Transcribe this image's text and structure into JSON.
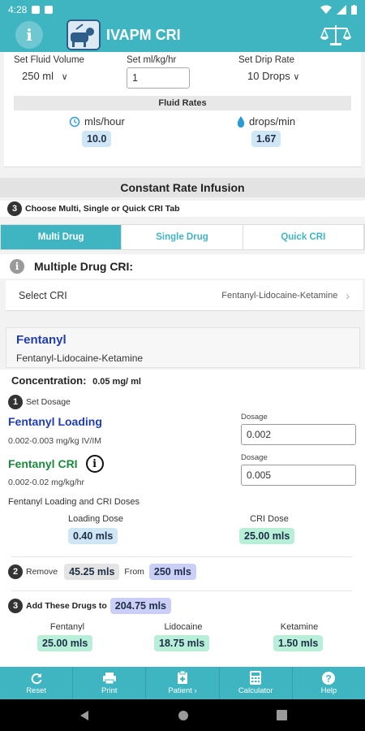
{
  "status": {
    "time": "4:28"
  },
  "app": {
    "title": "IVAPM CRI"
  },
  "fluid": {
    "volume_label": "Set Fluid Volume",
    "volume_value": "250 ml",
    "rate_label": "Set ml/kg/hr",
    "rate_value": "1",
    "drip_label": "Set Drip Rate",
    "drip_value": "10 Drops",
    "rates_header": "Fluid Rates",
    "mls_hour_label": "mls/hour",
    "mls_hour_value": "10.0",
    "drops_min_label": "drops/min",
    "drops_min_value": "1.67"
  },
  "cri": {
    "section_title": "Constant Rate Infusion",
    "step3_label": "Choose Multi, Single or Quick CRI Tab",
    "tabs": [
      {
        "label": "Multi Drug"
      },
      {
        "label": "Single Drug"
      },
      {
        "label": "Quick CRI"
      }
    ],
    "multi_title": "Multiple Drug CRI:",
    "select_label": "Select CRI",
    "select_value": "Fentanyl-Lidocaine-Ketamine"
  },
  "drug": {
    "name": "Fentanyl",
    "combo": "Fentanyl-Lidocaine-Ketamine",
    "concentration_label": "Concentration:",
    "concentration_value": "0.05 mg/ ml",
    "set_dosage_label": "Set Dosage",
    "loading_title": "Fentanyl Loading",
    "loading_range": "0.002-0.003 mg/kg IV/IM",
    "loading_dosage_label": "Dosage",
    "loading_dosage_value": "0.002",
    "cri_title": "Fentanyl CRI",
    "cri_range": "0.002-0.02 mg/kg/hr",
    "cri_dosage_label": "Dosage",
    "cri_dosage_value": "0.005",
    "doses_title": "Fentanyl Loading and CRI Doses",
    "loading_dose_label": "Loading Dose",
    "loading_dose_value": "0.40 mls",
    "cri_dose_label": "CRI Dose",
    "cri_dose_value": "25.00 mls",
    "remove_label": "Remove",
    "remove_value": "45.25 mls",
    "from_label": "From",
    "from_value": "250 mls",
    "add_label": "Add These Drugs to",
    "add_value": "204.75 mls",
    "additions": [
      {
        "name": "Fentanyl",
        "value": "25.00 mls"
      },
      {
        "name": "Lidocaine",
        "value": "18.75 mls"
      },
      {
        "name": "Ketamine",
        "value": "1.50 mls"
      }
    ]
  },
  "nav": [
    {
      "label": "Reset",
      "icon": "refresh-icon"
    },
    {
      "label": "Print",
      "icon": "printer-icon"
    },
    {
      "label": "Patient",
      "icon": "clipboard-icon"
    },
    {
      "label": "Calculator",
      "icon": "calculator-icon"
    },
    {
      "label": "Help",
      "icon": "help-icon"
    }
  ],
  "colors": {
    "primary": "#3fb5c2",
    "drug_title": "#1f3db5",
    "cri_title": "#1b8a3c",
    "pill_blue": "#cfe6f7",
    "pill_green": "#b8efd8"
  }
}
